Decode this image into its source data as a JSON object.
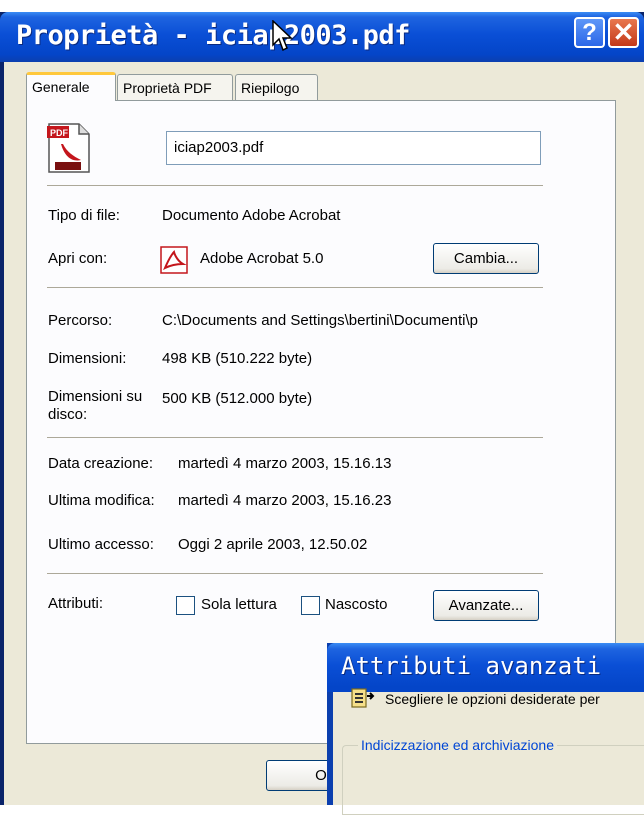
{
  "window": {
    "title": "Proprietà - iciap2003.pdf",
    "help_button": "?",
    "close_button": "✕"
  },
  "tabs": [
    {
      "label": "Generale",
      "active": true
    },
    {
      "label": "Proprietà PDF",
      "active": false
    },
    {
      "label": "Riepilogo",
      "active": false
    }
  ],
  "general": {
    "file_name": "iciap2003.pdf",
    "file_icon": "pdf-file-icon",
    "file_type_label": "Tipo di file:",
    "file_type_value": "Documento Adobe Acrobat",
    "open_with_label": "Apri con:",
    "open_with_value": "Adobe Acrobat 5.0",
    "open_with_icon": "acrobat-icon",
    "change_button": "Cambia...",
    "path_label": "Percorso:",
    "path_value": "C:\\Documents and Settings\\bertini\\Documenti\\p",
    "size_label": "Dimensioni:",
    "size_value": "498 KB (510.222 byte)",
    "size_on_disk_label_1": "Dimensioni su",
    "size_on_disk_label_2": "disco:",
    "size_on_disk_value": "500 KB (512.000 byte)",
    "created_label": "Data creazione:",
    "created_value": "martedì 4 marzo 2003, 15.16.13",
    "modified_label": "Ultima modifica:",
    "modified_value": "martedì 4 marzo 2003, 15.16.23",
    "accessed_label": "Ultimo accesso:",
    "accessed_value": "Oggi 2 aprile 2003, 12.50.02",
    "attributes_label": "Attributi:",
    "readonly_label": "Sola lettura",
    "readonly_checked": false,
    "hidden_label": "Nascosto",
    "hidden_checked": false,
    "advanced_button": "Avanzate..."
  },
  "footer": {
    "ok_button": "OK"
  },
  "advanced_dialog": {
    "title": "Attributi avanzati",
    "description": "Scegliere le opzioni desiderate per",
    "group_label": "Indicizzazione ed archiviazione",
    "icon": "folder-settings-icon"
  },
  "colors": {
    "titlebar": "#0a4fd6",
    "dialog_face": "#ece9d8",
    "tab_highlight": "#ffc83c"
  }
}
